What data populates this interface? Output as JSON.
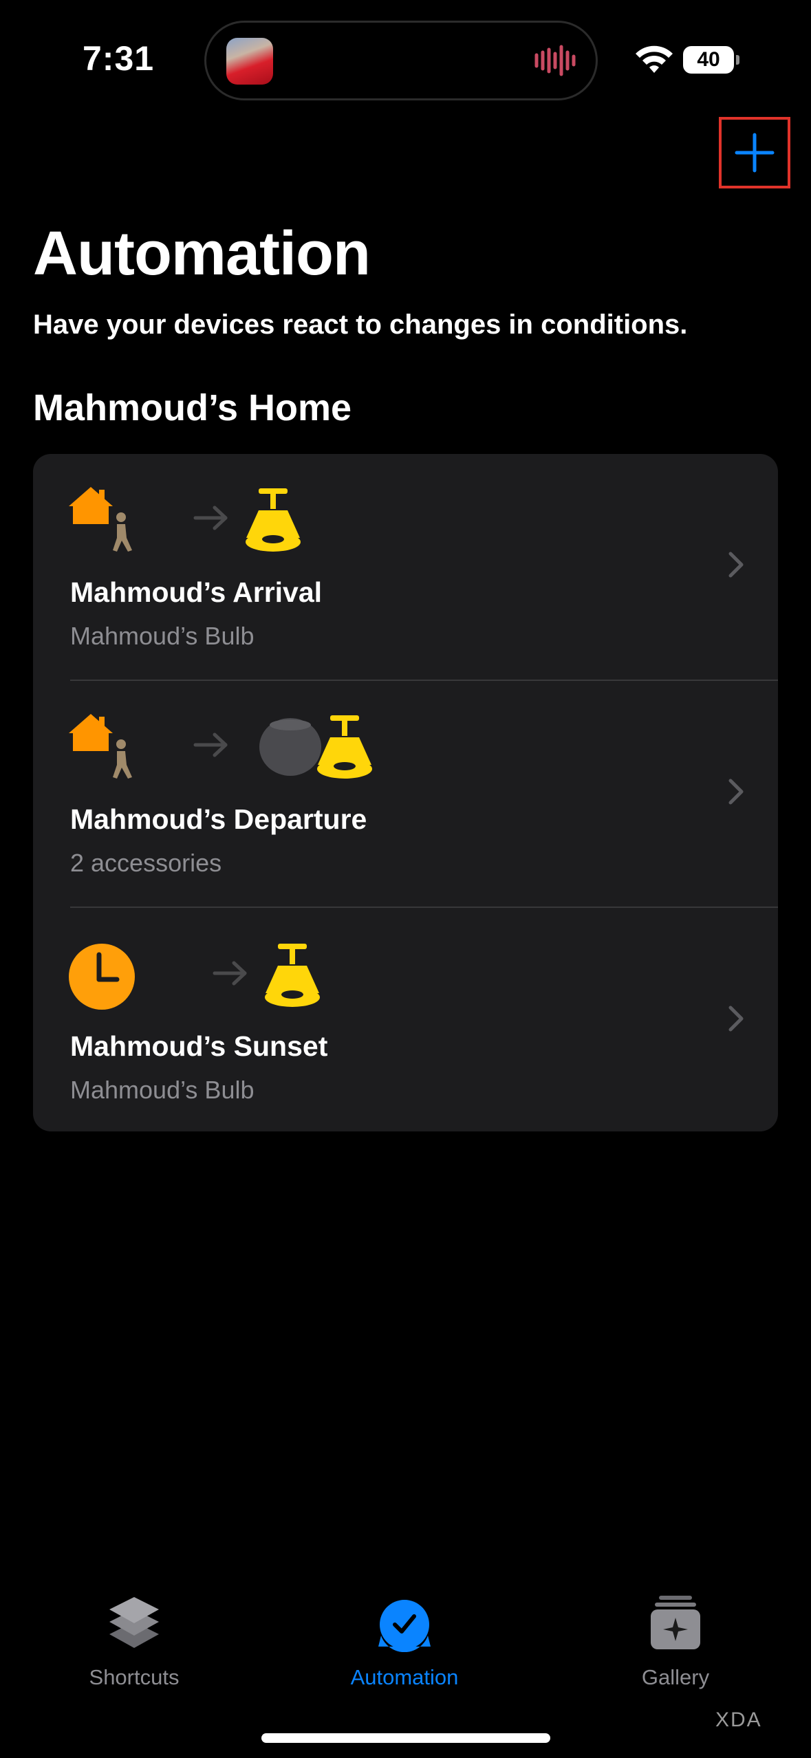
{
  "status_bar": {
    "time": "7:31",
    "battery": "40"
  },
  "header": {
    "title": "Automation",
    "subtitle": "Have your devices react to changes in conditions."
  },
  "section": {
    "title": "Mahmoud’s Home"
  },
  "automations": [
    {
      "name": "Mahmoud’s Arrival",
      "detail": "Mahmoud’s Bulb",
      "trigger_icon": "home-person-icon",
      "accessory_icons": [
        "ceiling-lamp-icon"
      ]
    },
    {
      "name": "Mahmoud’s Departure",
      "detail": "2 accessories",
      "trigger_icon": "home-person-icon",
      "accessory_icons": [
        "homepod-mini-icon",
        "ceiling-lamp-icon"
      ]
    },
    {
      "name": "Mahmoud’s Sunset",
      "detail": "Mahmoud’s Bulb",
      "trigger_icon": "clock-icon",
      "accessory_icons": [
        "ceiling-lamp-icon"
      ]
    }
  ],
  "tab_bar": {
    "tabs": [
      {
        "label": "Shortcuts",
        "icon": "stack-icon",
        "active": false
      },
      {
        "label": "Automation",
        "icon": "checkmark-circle-icon",
        "active": true
      },
      {
        "label": "Gallery",
        "icon": "gallery-sparkle-icon",
        "active": false
      }
    ]
  },
  "watermark": "XDA",
  "colors": {
    "accent": "#0a84ff",
    "home_orange": "#ff9500",
    "lamp_yellow": "#ffd60a",
    "card_bg": "#1c1c1e",
    "highlight_box": "#e0332a"
  }
}
